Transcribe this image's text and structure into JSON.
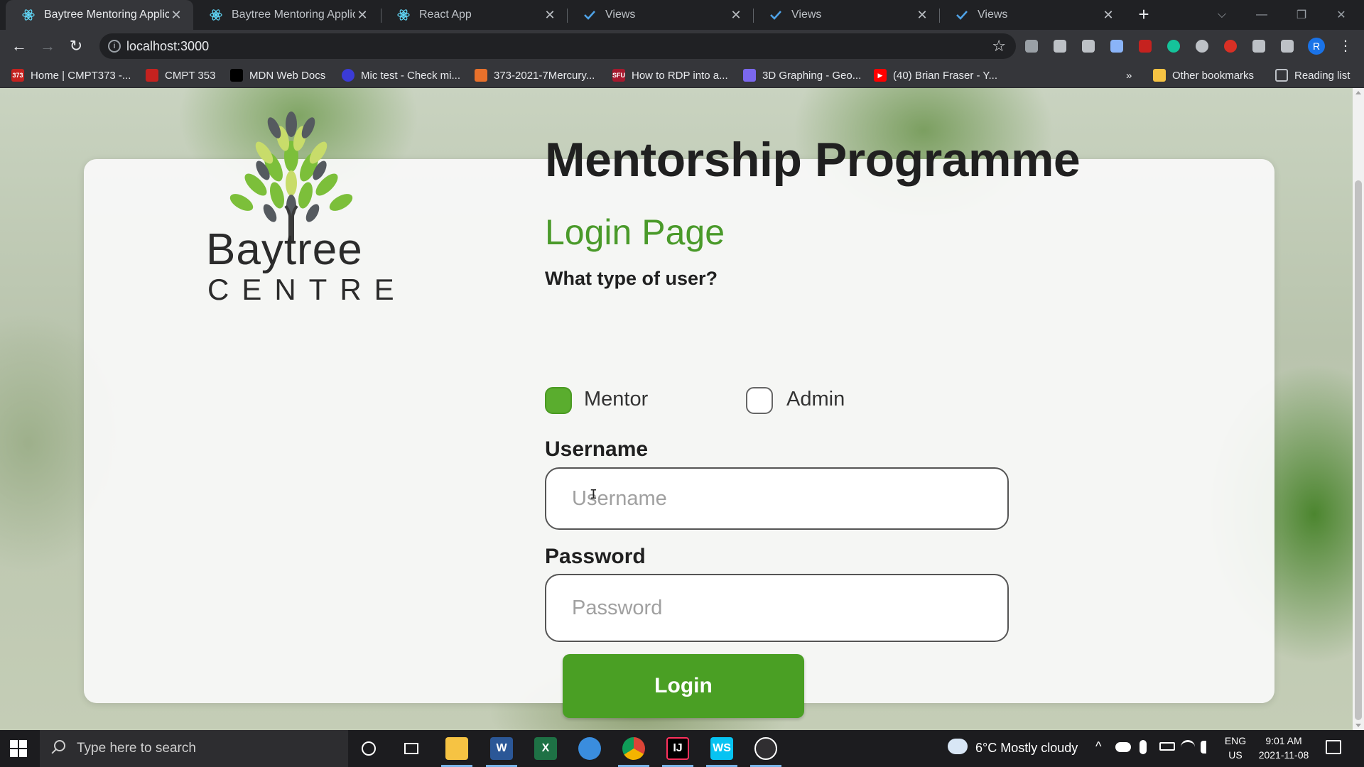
{
  "tabs": [
    {
      "title": "Baytree Mentoring Applicati",
      "icon": "react-icon",
      "active": true
    },
    {
      "title": "Baytree Mentoring Applicati",
      "icon": "react-icon",
      "active": false
    },
    {
      "title": "React App",
      "icon": "react-icon",
      "active": false
    },
    {
      "title": "Views",
      "icon": "checkmark-icon",
      "active": false
    },
    {
      "title": "Views",
      "icon": "checkmark-icon",
      "active": false
    },
    {
      "title": "Views",
      "icon": "checkmark-icon",
      "active": false
    }
  ],
  "tab_close_glyph": "✕",
  "new_tab_glyph": "+",
  "window_controls": {
    "dropdown": "⌵",
    "minimize": "—",
    "restore": "❐",
    "close": "✕"
  },
  "address_bar": {
    "url": "localhost:3000",
    "back": "←",
    "forward": "→",
    "reload": "↻",
    "star": "☆",
    "menu": "⋮",
    "profile_initial": "R"
  },
  "extensions": [
    "#9aa0a6",
    "#bdc1c6",
    "#bdc1c6",
    "#8ab4f8",
    "#c5221f",
    "#15c39a",
    "#bdc1c6",
    "#d93025",
    "#bdc1c6",
    "#bdc1c6"
  ],
  "bookmarks": [
    {
      "label": "Home | CMPT373 -...",
      "icon_text": "373",
      "color": "#c5221f"
    },
    {
      "label": "CMPT 353",
      "icon_text": "",
      "color": "#c5221f"
    },
    {
      "label": "MDN Web Docs",
      "icon_text": "",
      "color": "#000000"
    },
    {
      "label": "Mic test - Check mi...",
      "icon_text": "",
      "color": "#3b3bd6"
    },
    {
      "label": "373-2021-7Mercury...",
      "icon_text": "",
      "color": "#e8712b"
    },
    {
      "label": "How to RDP into a...",
      "icon_text": "SFU",
      "color": "#a6192e"
    },
    {
      "label": "3D Graphing - Geo...",
      "icon_text": "",
      "color": "#7b68ee"
    },
    {
      "label": "(40) Brian Fraser - Y...",
      "icon_text": "▶",
      "color": "#ff0000"
    }
  ],
  "bookmarks_overflow": "»",
  "other_bookmarks": "Other bookmarks",
  "reading_list": "Reading list",
  "page": {
    "logo_line1": "Baytree",
    "logo_line2": "CENTRE",
    "title": "Mentorship Programme",
    "subtitle": "Login Page",
    "user_type_question": "What type of user?",
    "user_types": [
      {
        "label": "Mentor",
        "checked": true
      },
      {
        "label": "Admin",
        "checked": false
      }
    ],
    "username_label": "Username",
    "username_placeholder": "Username",
    "password_label": "Password",
    "password_placeholder": "Password",
    "login_button": "Login",
    "brand_green": "#4a9f24"
  },
  "taskbar": {
    "search_placeholder": "Type here to search",
    "weather": "6°C  Mostly cloudy",
    "language": "ENG",
    "region": "US",
    "time": "9:01 AM",
    "date": "2021-11-08"
  }
}
